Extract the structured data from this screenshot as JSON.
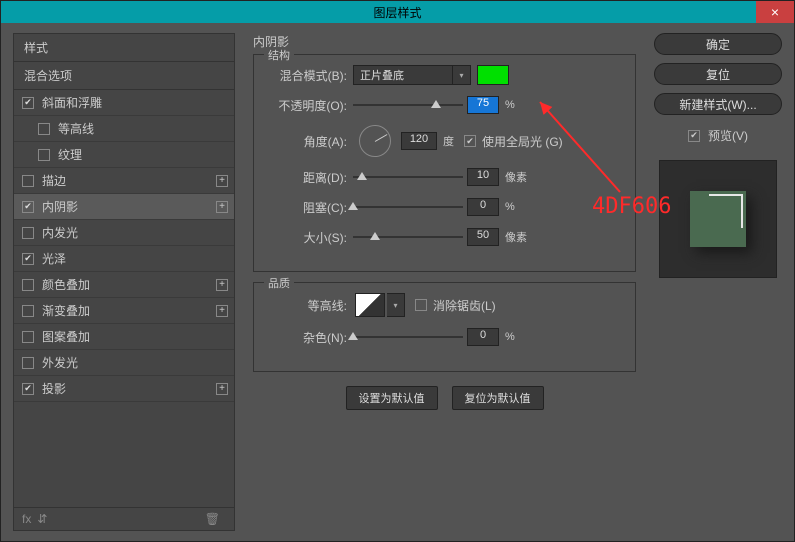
{
  "window": {
    "title": "图层样式",
    "close": "×"
  },
  "sidebar": {
    "head": "样式",
    "sub": "混合选项",
    "items": [
      {
        "label": "斜面和浮雕",
        "checked": true,
        "plus": false,
        "indent": false
      },
      {
        "label": "等高线",
        "checked": false,
        "plus": false,
        "indent": true
      },
      {
        "label": "纹理",
        "checked": false,
        "plus": false,
        "indent": true
      },
      {
        "label": "描边",
        "checked": false,
        "plus": true,
        "indent": false
      },
      {
        "label": "内阴影",
        "checked": true,
        "plus": true,
        "indent": false,
        "selected": true
      },
      {
        "label": "内发光",
        "checked": false,
        "plus": false,
        "indent": false
      },
      {
        "label": "光泽",
        "checked": true,
        "plus": false,
        "indent": false
      },
      {
        "label": "颜色叠加",
        "checked": false,
        "plus": true,
        "indent": false
      },
      {
        "label": "渐变叠加",
        "checked": false,
        "plus": true,
        "indent": false
      },
      {
        "label": "图案叠加",
        "checked": false,
        "plus": false,
        "indent": false
      },
      {
        "label": "外发光",
        "checked": false,
        "plus": false,
        "indent": false
      },
      {
        "label": "投影",
        "checked": true,
        "plus": true,
        "indent": false
      }
    ],
    "foot_fx": "fx"
  },
  "main": {
    "title": "内阴影",
    "struct_legend": "结构",
    "blend_label": "混合模式(B):",
    "blend_value": "正片叠底",
    "swatch_color": "#00e000",
    "opacity_label": "不透明度(O):",
    "opacity_value": "75",
    "percent": "%",
    "angle_label": "角度(A):",
    "angle_value": "120",
    "angle_unit": "度",
    "global_light": "使用全局光 (G)",
    "distance_label": "距离(D):",
    "distance_value": "10",
    "px": "像素",
    "choke_label": "阻塞(C):",
    "choke_value": "0",
    "size_label": "大小(S):",
    "size_value": "50",
    "quality_legend": "品质",
    "contour_label": "等高线:",
    "antialias": "消除锯齿(L)",
    "noise_label": "杂色(N):",
    "noise_value": "0",
    "btn_default": "设置为默认值",
    "btn_reset": "复位为默认值"
  },
  "right": {
    "ok": "确定",
    "cancel": "复位",
    "new_style": "新建样式(W)...",
    "preview": "预览(V)"
  },
  "annotation": "4DF606"
}
